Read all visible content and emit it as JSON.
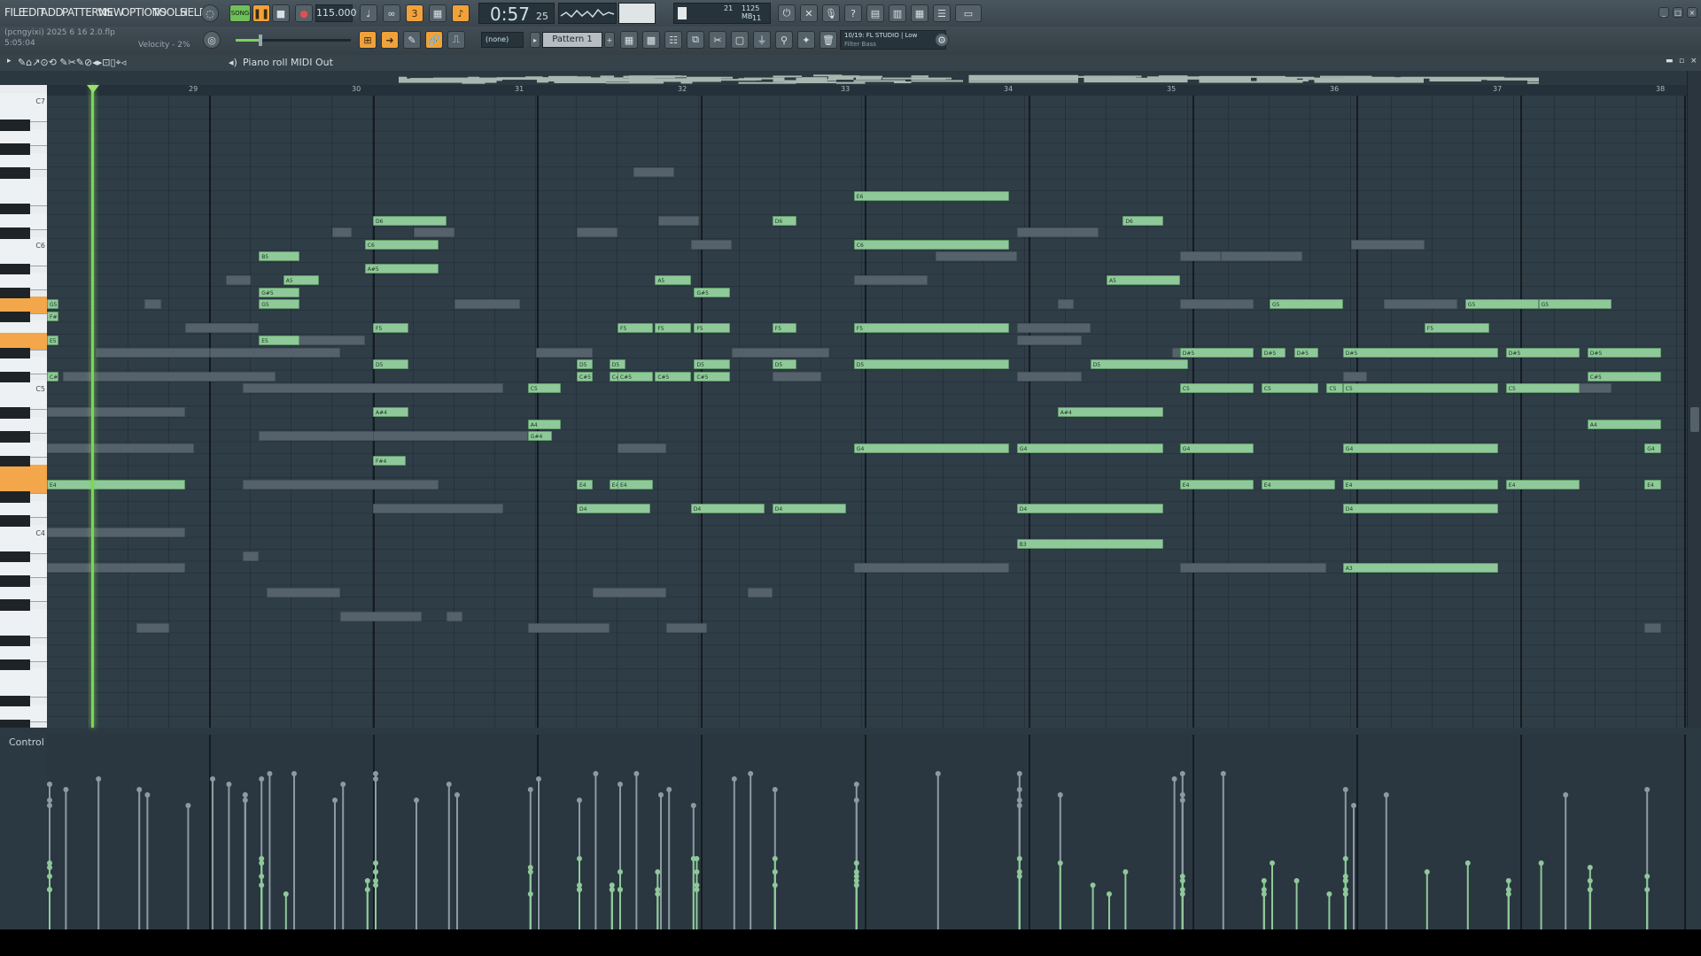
{
  "menu": [
    "FILE",
    "EDIT",
    "ADD",
    "PATTERNS",
    "VIEW",
    "OPTIONS",
    "TOOLS",
    "HELP"
  ],
  "project": {
    "file": "(pcngyixi) 2025 6 16 2.0.flp",
    "time": "5:05:04",
    "hint": "Velocity - 2%"
  },
  "transport": {
    "mode": "SONG",
    "tempo": "115.000",
    "time": "0:57",
    "time_sub": "25",
    "cpu": "21",
    "mem": "1125 MB",
    "voices": "11"
  },
  "pattern": {
    "name": "Pattern 1",
    "channel": "(none)"
  },
  "news": {
    "line1": "10/19: FL STUDIO | Low",
    "line2": "Filter Bass"
  },
  "piano_roll": {
    "title": "Piano roll",
    "target": "MIDI Out"
  },
  "bars": [
    "29",
    "30",
    "31",
    "32",
    "33",
    "34",
    "35",
    "36",
    "37",
    "38"
  ],
  "octave_labels": [
    "C7",
    "C6",
    "C5",
    "C4"
  ],
  "control": {
    "label": "Control"
  },
  "colors": {
    "note": "#8fc99a",
    "ghost": "#56626b",
    "playhead": "#7cd655",
    "highlight_key": "#f3a64a"
  },
  "notes": [
    {
      "p": 86,
      "s": 2.0,
      "l": 0.45,
      "n": "D6"
    },
    {
      "p": 83,
      "s": 1.3,
      "l": 0.25,
      "n": "B5"
    },
    {
      "p": 81,
      "s": 1.45,
      "l": 0.22,
      "n": "A5"
    },
    {
      "p": 82,
      "s": 1.95,
      "l": 0.45,
      "n": "A#5"
    },
    {
      "p": 84,
      "s": 1.95,
      "l": 0.45,
      "n": "C6"
    },
    {
      "p": 79,
      "s": 0.0,
      "l": 0.07,
      "n": "G5"
    },
    {
      "p": 79,
      "s": 1.3,
      "l": 0.25,
      "n": "G5"
    },
    {
      "p": 76,
      "s": 0.0,
      "l": 0.07,
      "n": "E5"
    },
    {
      "p": 76,
      "s": 1.3,
      "l": 0.25,
      "n": "E5"
    },
    {
      "p": 73,
      "s": 0.0,
      "l": 0.07,
      "n": "C#5"
    },
    {
      "p": 78,
      "s": 0.0,
      "l": 0.07,
      "n": "F#5"
    },
    {
      "p": 80,
      "s": 1.3,
      "l": 0.25,
      "n": "G#5"
    },
    {
      "p": 64,
      "s": 0.0,
      "l": 0.85,
      "n": "E4"
    },
    {
      "p": 66,
      "s": 2.0,
      "l": 0.2,
      "n": "F#4"
    },
    {
      "p": 70,
      "s": 2.0,
      "l": 0.22,
      "n": "A#4"
    },
    {
      "p": 74,
      "s": 2.0,
      "l": 0.22,
      "n": "D5"
    },
    {
      "p": 77,
      "s": 2.0,
      "l": 0.22,
      "n": "F5"
    },
    {
      "p": 69,
      "s": 2.95,
      "l": 0.2,
      "n": "A4"
    },
    {
      "p": 72,
      "s": 2.95,
      "l": 0.2,
      "n": "C5"
    },
    {
      "p": 68,
      "s": 2.95,
      "l": 0.15,
      "n": "G#4"
    },
    {
      "p": 73,
      "s": 3.25,
      "l": 0.1,
      "n": "C#5"
    },
    {
      "p": 74,
      "s": 3.25,
      "l": 0.1,
      "n": "D5"
    },
    {
      "p": 73,
      "s": 3.45,
      "l": 0.1,
      "n": "C#5"
    },
    {
      "p": 74,
      "s": 3.45,
      "l": 0.1,
      "n": "D5"
    },
    {
      "p": 64,
      "s": 3.25,
      "l": 0.1,
      "n": "E4"
    },
    {
      "p": 64,
      "s": 3.45,
      "l": 0.1,
      "n": "E4"
    },
    {
      "p": 62,
      "s": 3.25,
      "l": 0.45,
      "n": "D4"
    },
    {
      "p": 77,
      "s": 3.5,
      "l": 0.22,
      "n": "F5"
    },
    {
      "p": 77,
      "s": 3.73,
      "l": 0.22,
      "n": "F5"
    },
    {
      "p": 73,
      "s": 3.5,
      "l": 0.22,
      "n": "C#5"
    },
    {
      "p": 73,
      "s": 3.73,
      "l": 0.22,
      "n": "C#5"
    },
    {
      "p": 64,
      "s": 3.5,
      "l": 0.22,
      "n": "E4"
    },
    {
      "p": 81,
      "s": 3.73,
      "l": 0.22,
      "n": "A5"
    },
    {
      "p": 77,
      "s": 3.97,
      "l": 0.22,
      "n": "F5"
    },
    {
      "p": 74,
      "s": 3.97,
      "l": 0.22,
      "n": "D5"
    },
    {
      "p": 73,
      "s": 3.97,
      "l": 0.22,
      "n": "C#5"
    },
    {
      "p": 80,
      "s": 3.97,
      "l": 0.22,
      "n": "G#5"
    },
    {
      "p": 62,
      "s": 3.95,
      "l": 0.45,
      "n": "D4"
    },
    {
      "p": 86,
      "s": 4.45,
      "l": 0.15,
      "n": "D6"
    },
    {
      "p": 77,
      "s": 4.45,
      "l": 0.15,
      "n": "F5"
    },
    {
      "p": 74,
      "s": 4.45,
      "l": 0.15,
      "n": "D5"
    },
    {
      "p": 62,
      "s": 4.45,
      "l": 0.45,
      "n": "D4"
    },
    {
      "p": 88,
      "s": 4.95,
      "l": 0.95,
      "n": "E6"
    },
    {
      "p": 84,
      "s": 4.95,
      "l": 0.95,
      "n": "C6"
    },
    {
      "p": 77,
      "s": 4.95,
      "l": 0.95,
      "n": "F5"
    },
    {
      "p": 74,
      "s": 4.95,
      "l": 0.95,
      "n": "D5"
    },
    {
      "p": 67,
      "s": 4.95,
      "l": 0.95,
      "n": "G4"
    },
    {
      "p": 67,
      "s": 5.95,
      "l": 0.9,
      "n": "G4"
    },
    {
      "p": 62,
      "s": 5.95,
      "l": 0.9,
      "n": "D4"
    },
    {
      "p": 59,
      "s": 5.95,
      "l": 0.9,
      "n": "B3"
    },
    {
      "p": 70,
      "s": 6.2,
      "l": 0.65,
      "n": "A#4"
    },
    {
      "p": 74,
      "s": 6.4,
      "l": 0.6,
      "n": "D5"
    },
    {
      "p": 81,
      "s": 6.5,
      "l": 0.45,
      "n": "A5"
    },
    {
      "p": 86,
      "s": 6.6,
      "l": 0.25,
      "n": "D6"
    },
    {
      "p": 75,
      "s": 6.95,
      "l": 0.45,
      "n": "D#5"
    },
    {
      "p": 72,
      "s": 6.95,
      "l": 0.45,
      "n": "C5"
    },
    {
      "p": 67,
      "s": 6.95,
      "l": 0.45,
      "n": "G4"
    },
    {
      "p": 64,
      "s": 6.95,
      "l": 0.45,
      "n": "E4"
    },
    {
      "p": 75,
      "s": 7.45,
      "l": 0.15,
      "n": "D#5"
    },
    {
      "p": 75,
      "s": 7.65,
      "l": 0.15,
      "n": "D#5"
    },
    {
      "p": 72,
      "s": 7.45,
      "l": 0.35,
      "n": "C5"
    },
    {
      "p": 72,
      "s": 7.85,
      "l": 0.1,
      "n": "C5"
    },
    {
      "p": 64,
      "s": 7.45,
      "l": 0.45,
      "n": "E4"
    },
    {
      "p": 79,
      "s": 7.5,
      "l": 0.45,
      "n": "G5"
    },
    {
      "p": 75,
      "s": 7.95,
      "l": 0.95,
      "n": "D#5"
    },
    {
      "p": 72,
      "s": 7.95,
      "l": 0.95,
      "n": "C5"
    },
    {
      "p": 67,
      "s": 7.95,
      "l": 0.95,
      "n": "G4"
    },
    {
      "p": 64,
      "s": 7.95,
      "l": 0.95,
      "n": "E4"
    },
    {
      "p": 62,
      "s": 7.95,
      "l": 0.95,
      "n": "D4"
    },
    {
      "p": 57,
      "s": 7.95,
      "l": 0.95,
      "n": "A3"
    },
    {
      "p": 79,
      "s": 8.7,
      "l": 0.45,
      "n": "G5"
    },
    {
      "p": 77,
      "s": 8.45,
      "l": 0.4,
      "n": "F5"
    },
    {
      "p": 75,
      "s": 8.95,
      "l": 0.45,
      "n": "D#5"
    },
    {
      "p": 72,
      "s": 8.95,
      "l": 0.45,
      "n": "C5"
    },
    {
      "p": 64,
      "s": 8.95,
      "l": 0.45,
      "n": "E4"
    },
    {
      "p": 79,
      "s": 9.15,
      "l": 0.45,
      "n": "G5"
    },
    {
      "p": 73,
      "s": 9.45,
      "l": 0.45,
      "n": "C#5"
    },
    {
      "p": 69,
      "s": 9.45,
      "l": 0.45,
      "n": "A4"
    },
    {
      "p": 75,
      "s": 9.45,
      "l": 0.45,
      "n": "D#5"
    },
    {
      "p": 67,
      "s": 9.8,
      "l": 0.1,
      "n": "G4"
    },
    {
      "p": 64,
      "s": 9.8,
      "l": 0.1,
      "n": "E4"
    }
  ],
  "ghosts": [
    {
      "p": 90,
      "s": 3.6,
      "l": 0.25
    },
    {
      "p": 86,
      "s": 3.75,
      "l": 0.25
    },
    {
      "p": 85,
      "s": 1.75,
      "l": 0.12
    },
    {
      "p": 85,
      "s": 2.25,
      "l": 0.25
    },
    {
      "p": 85,
      "s": 3.25,
      "l": 0.25
    },
    {
      "p": 85,
      "s": 5.95,
      "l": 0.5
    },
    {
      "p": 83,
      "s": 5.45,
      "l": 0.5
    },
    {
      "p": 83,
      "s": 6.95,
      "l": 0.25
    },
    {
      "p": 84,
      "s": 3.95,
      "l": 0.25
    },
    {
      "p": 84,
      "s": 8.0,
      "l": 0.45
    },
    {
      "p": 83,
      "s": 7.2,
      "l": 0.5
    },
    {
      "p": 81,
      "s": 1.1,
      "l": 0.15
    },
    {
      "p": 81,
      "s": 4.95,
      "l": 0.45
    },
    {
      "p": 79,
      "s": 0.6,
      "l": 0.1
    },
    {
      "p": 79,
      "s": 2.5,
      "l": 0.4
    },
    {
      "p": 79,
      "s": 6.2,
      "l": 0.1
    },
    {
      "p": 79,
      "s": 6.95,
      "l": 0.45
    },
    {
      "p": 79,
      "s": 8.2,
      "l": 0.45
    },
    {
      "p": 77,
      "s": 0.85,
      "l": 0.45
    },
    {
      "p": 77,
      "s": 5.95,
      "l": 0.45
    },
    {
      "p": 76,
      "s": 1.5,
      "l": 0.45
    },
    {
      "p": 76,
      "s": 5.95,
      "l": 0.4
    },
    {
      "p": 75,
      "s": 0.3,
      "l": 0.7
    },
    {
      "p": 75,
      "s": 1.0,
      "l": 0.8
    },
    {
      "p": 75,
      "s": 3.0,
      "l": 0.35
    },
    {
      "p": 75,
      "s": 4.2,
      "l": 0.6
    },
    {
      "p": 75,
      "s": 6.9,
      "l": 0.15
    },
    {
      "p": 73,
      "s": 0.1,
      "l": 1.3
    },
    {
      "p": 73,
      "s": 4.45,
      "l": 0.3
    },
    {
      "p": 73,
      "s": 5.95,
      "l": 0.4
    },
    {
      "p": 73,
      "s": 7.95,
      "l": 0.15
    },
    {
      "p": 72,
      "s": 1.2,
      "l": 1.6
    },
    {
      "p": 72,
      "s": 9.3,
      "l": 0.3
    },
    {
      "p": 70,
      "s": 0.0,
      "l": 0.85
    },
    {
      "p": 68,
      "s": 1.3,
      "l": 1.0
    },
    {
      "p": 68,
      "s": 2.0,
      "l": 0.95
    },
    {
      "p": 67,
      "s": 0.0,
      "l": 0.9
    },
    {
      "p": 67,
      "s": 3.5,
      "l": 0.3
    },
    {
      "p": 64,
      "s": 1.2,
      "l": 1.2
    },
    {
      "p": 62,
      "s": 2.0,
      "l": 0.8
    },
    {
      "p": 60,
      "s": 0.0,
      "l": 0.85
    },
    {
      "p": 58,
      "s": 1.2,
      "l": 0.1
    },
    {
      "p": 57,
      "s": 0.0,
      "l": 0.85
    },
    {
      "p": 57,
      "s": 4.95,
      "l": 0.95
    },
    {
      "p": 57,
      "s": 6.95,
      "l": 0.9
    },
    {
      "p": 55,
      "s": 1.35,
      "l": 0.45
    },
    {
      "p": 55,
      "s": 3.35,
      "l": 0.45
    },
    {
      "p": 55,
      "s": 4.3,
      "l": 0.15
    },
    {
      "p": 53,
      "s": 1.8,
      "l": 0.5
    },
    {
      "p": 53,
      "s": 2.45,
      "l": 0.1
    },
    {
      "p": 52,
      "s": 0.55,
      "l": 0.2
    },
    {
      "p": 52,
      "s": 2.95,
      "l": 0.5
    },
    {
      "p": 52,
      "s": 3.8,
      "l": 0.25
    },
    {
      "p": 52,
      "s": 9.8,
      "l": 0.1
    }
  ]
}
